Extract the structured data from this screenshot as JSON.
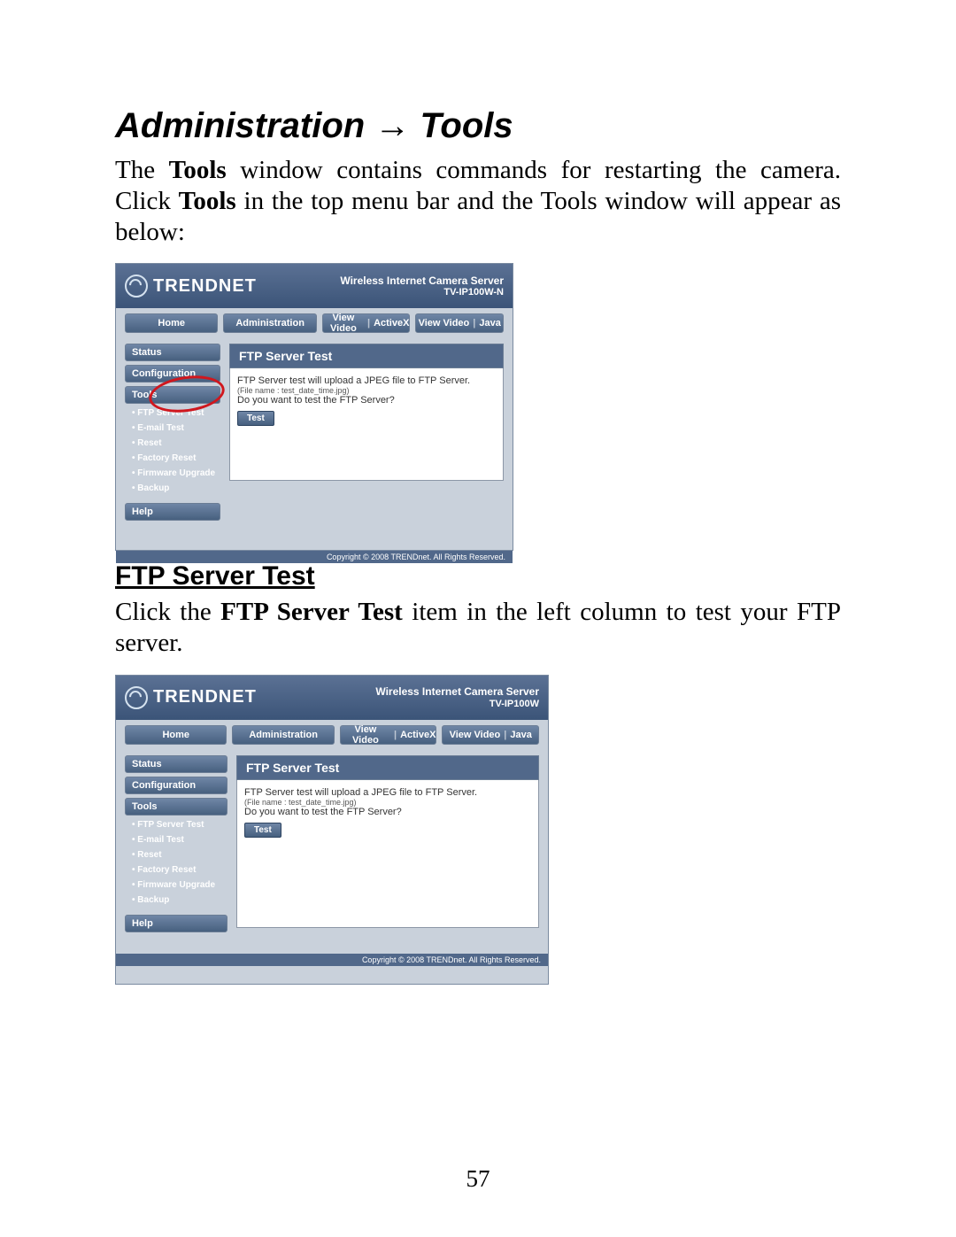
{
  "doc": {
    "heading": "Administration → Tools",
    "para1_a": "The ",
    "para1_b": "Tools",
    "para1_c": " window contains commands for restarting the camera. Click ",
    "para1_d": "Tools",
    "para1_e": " in the top menu bar and the Tools window will appear as below:",
    "subheading": "FTP Server Test",
    "para2_a": "Click the ",
    "para2_b": "FTP Server Test",
    "para2_c": " item in the left column to test your FTP server.",
    "page_number": "57"
  },
  "shot1": {
    "logo": "TRENDNET",
    "header_title": "Wireless Internet Camera Server",
    "model": "TV-IP100W-N",
    "menu": {
      "home": "Home",
      "admin": "Administration",
      "vv_ax_a": "View Video",
      "vv_ax_b": "ActiveX",
      "vv_j_a": "View Video",
      "vv_j_b": "Java"
    },
    "sidebar": {
      "status": "Status",
      "config": "Configuration",
      "tools": "Tools",
      "items": {
        "ftp": "FTP Server Test",
        "email": "E-mail Test",
        "reset": "Reset",
        "factory": "Factory Reset",
        "fw": "Firmware Upgrade",
        "backup": "Backup"
      },
      "help": "Help"
    },
    "panel": {
      "title": "FTP Server Test",
      "line1": "FTP Server test will upload a JPEG file to FTP Server.",
      "line2": "(File name : test_date_time.jpg)",
      "line3": "Do you want to test the FTP Server?",
      "button": "Test"
    },
    "footer": "Copyright © 2008 TRENDnet. All Rights Reserved."
  },
  "shot2": {
    "logo": "TRENDNET",
    "header_title": "Wireless Internet Camera Server",
    "model": "TV-IP100W",
    "menu": {
      "home": "Home",
      "admin": "Administration",
      "vv_ax_a": "View Video",
      "vv_ax_b": "ActiveX",
      "vv_j_a": "View Video",
      "vv_j_b": "Java"
    },
    "sidebar": {
      "status": "Status",
      "config": "Configuration",
      "tools": "Tools",
      "items": {
        "ftp": "FTP Server Test",
        "email": "E-mail Test",
        "reset": "Reset",
        "factory": "Factory Reset",
        "fw": "Firmware Upgrade",
        "backup": "Backup"
      },
      "help": "Help"
    },
    "panel": {
      "title": "FTP Server Test",
      "line1": "FTP Server test will upload a JPEG file to FTP Server.",
      "line2": "(File name : test_date_time.jpg)",
      "line3": "Do you want to test the FTP Server?",
      "button": "Test"
    },
    "footer": "Copyright © 2008 TRENDnet. All Rights Reserved."
  }
}
